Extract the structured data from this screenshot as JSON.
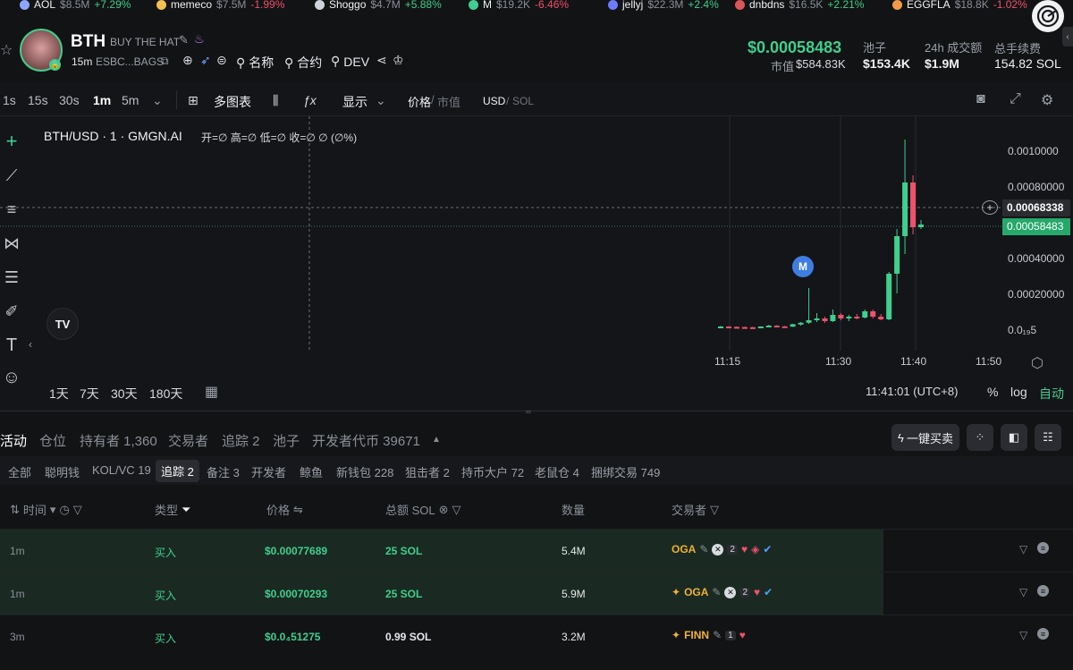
{
  "ticker": [
    {
      "name": "AOL",
      "mcap": "$8.5M",
      "change": "+7.29%",
      "dir": "up",
      "color": "#8fa6ff"
    },
    {
      "name": "memeco",
      "mcap": "$7.5M",
      "change": "-1.99%",
      "dir": "dn",
      "color": "#f2c14e"
    },
    {
      "name": "Shoggo",
      "mcap": "$4.7M",
      "change": "+5.88%",
      "dir": "up",
      "color": "#cfd3da"
    },
    {
      "name": "M",
      "mcap": "$19.2K",
      "change": "-6.46%",
      "dir": "dn",
      "color": "#3fcf8e"
    },
    {
      "name": "jellyj",
      "mcap": "$22.3M",
      "change": "+2.4%",
      "dir": "up",
      "color": "#6c7cff"
    },
    {
      "name": "dnbdns",
      "mcap": "$16.5K",
      "change": "+2.21%",
      "dir": "up",
      "color": "#d95757"
    },
    {
      "name": "EGGFLA",
      "mcap": "$18.8K",
      "change": "-1.02%",
      "dir": "dn",
      "color": "#f39a4a"
    }
  ],
  "token": {
    "symbol": "BTH",
    "fullname": "BUY THE HAT",
    "age": "15m",
    "address": "ESBC...BAGS",
    "links": [
      "名称",
      "合约",
      "DEV"
    ]
  },
  "stats": {
    "price": "$0.00058483",
    "mcap_label": "市值",
    "mcap": "$584.83K",
    "pool_label": "池子",
    "pool": "$153.4K",
    "vol_label": "24h 成交额",
    "vol": "$1.9M",
    "fee_label": "总手续费",
    "fee": "154.82 SOL"
  },
  "toolbar": {
    "intervals": [
      "1s",
      "15s",
      "30s",
      "1m",
      "5m"
    ],
    "active_interval": "1m",
    "multi": "多图表",
    "display": "显示",
    "price_label": "价格",
    "mcap_label": "市值",
    "usd_label": "USD",
    "sol_label": "SOL"
  },
  "chart": {
    "legend": "BTH/USD · 1 · GMGN.AI",
    "ohlc": "开=∅ 高=∅ 低=∅ 收=∅ ∅ (∅%)",
    "crosshair_price": "0.00068338",
    "last_price": "0.00058483",
    "y_ticks": [
      "0.0010000",
      "0.00080000",
      "0.00060000",
      "0.00040000",
      "0.00020000",
      "0.0₁₉5"
    ],
    "x_ticks": [
      "11:15",
      "11:30",
      "11:40",
      "11:50"
    ],
    "ranges": [
      "1天",
      "7天",
      "30天",
      "180天"
    ],
    "time": "11:41:01 (UTC+8)",
    "pct": "%",
    "log": "log",
    "auto": "自动",
    "marker": "M",
    "tv_logo": "TV"
  },
  "chart_data": {
    "type": "candlestick",
    "ylim": [
      0,
      0.0011
    ],
    "x_ticks": [
      "11:15",
      "11:30",
      "11:40",
      "11:50"
    ],
    "candles_note": "",
    "candles": [
      {
        "o": 1.2e-05,
        "h": 1.8e-05,
        "l": 1e-05,
        "c": 1.5e-05
      },
      {
        "o": 1.5e-05,
        "h": 1.6e-05,
        "l": 1.2e-05,
        "c": 1.3e-05
      },
      {
        "o": 1.3e-05,
        "h": 1.5e-05,
        "l": 1.1e-05,
        "c": 1.2e-05
      },
      {
        "o": 1.2e-05,
        "h": 1.4e-05,
        "l": 1e-05,
        "c": 1.1e-05
      },
      {
        "o": 1.1e-05,
        "h": 1.3e-05,
        "l": 9e-06,
        "c": 1e-05
      },
      {
        "o": 1e-05,
        "h": 1.6e-05,
        "l": 9e-06,
        "c": 1.5e-05
      },
      {
        "o": 1.5e-05,
        "h": 2.4e-05,
        "l": 1.3e-05,
        "c": 2e-05
      },
      {
        "o": 2e-05,
        "h": 2.2e-05,
        "l": 1.4e-05,
        "c": 1.6e-05
      },
      {
        "o": 1.6e-05,
        "h": 1.8e-05,
        "l": 1.3e-05,
        "c": 1.4e-05
      },
      {
        "o": 1.4e-05,
        "h": 3e-05,
        "l": 1.3e-05,
        "c": 2.8e-05
      },
      {
        "o": 2.8e-05,
        "h": 4e-05,
        "l": 2e-05,
        "c": 3.6e-05
      },
      {
        "o": 3.6e-05,
        "h": 0.00023,
        "l": 3e-05,
        "c": 5e-05
      },
      {
        "o": 5e-05,
        "h": 9e-05,
        "l": 4e-05,
        "c": 6e-05
      },
      {
        "o": 6e-05,
        "h": 7e-05,
        "l": 3.5e-05,
        "c": 4.5e-05
      },
      {
        "o": 4.5e-05,
        "h": 0.00011,
        "l": 4e-05,
        "c": 8e-05
      },
      {
        "o": 8e-05,
        "h": 9e-05,
        "l": 5e-05,
        "c": 6e-05
      },
      {
        "o": 6e-05,
        "h": 8e-05,
        "l": 4.5e-05,
        "c": 7e-05
      },
      {
        "o": 7e-05,
        "h": 8.5e-05,
        "l": 5.5e-05,
        "c": 6.5e-05
      },
      {
        "o": 6.5e-05,
        "h": 0.00011,
        "l": 6e-05,
        "c": 0.0001
      },
      {
        "o": 0.0001,
        "h": 0.00011,
        "l": 6e-05,
        "c": 7e-05
      },
      {
        "o": 7e-05,
        "h": 8.5e-05,
        "l": 5e-05,
        "c": 5.5e-05
      },
      {
        "o": 5.5e-05,
        "h": 0.00032,
        "l": 5e-05,
        "c": 0.00031
      },
      {
        "o": 0.00031,
        "h": 0.00056,
        "l": 0.0002,
        "c": 0.00052
      },
      {
        "o": 0.00052,
        "h": 0.00106,
        "l": 0.00042,
        "c": 0.00082
      },
      {
        "o": 0.00082,
        "h": 0.00086,
        "l": 0.00053,
        "c": 0.00057
      },
      {
        "o": 0.00057,
        "h": 0.00061,
        "l": 0.00056,
        "c": 0.000585
      }
    ]
  },
  "tabs": {
    "main": [
      "活动",
      "仓位",
      "持有者 1,360",
      "交易者",
      "追踪 2",
      "池子",
      "开发者代币 39671"
    ],
    "active": "活动",
    "quick_buy": "一键买卖",
    "sub": [
      "全部",
      "聪明钱",
      "KOL/VC 19",
      "追踪 2",
      "备注 3",
      "开发者",
      "鲸鱼",
      "新钱包 228",
      "狙击者 2",
      "持币大户 72",
      "老鼠仓 4",
      "捆绑交易 749"
    ],
    "sub_active": "追踪 2"
  },
  "table": {
    "headers": {
      "time": "时间",
      "type": "类型",
      "price": "价格",
      "total": "总额 SOL",
      "qty": "数量",
      "trader": "交易者"
    },
    "rows": [
      {
        "time": "1m",
        "type": "买入",
        "price": "$0.00077689",
        "total": "25 SOL",
        "qty": "5.4M",
        "trader": "OGA",
        "count": "2",
        "highlight": true
      },
      {
        "time": "1m",
        "type": "买入",
        "price": "$0.00070293",
        "total": "25 SOL",
        "qty": "5.9M",
        "trader": "OGA",
        "count": "2",
        "highlight": true
      },
      {
        "time": "3m",
        "type": "买入",
        "price": "$0.0₄51275",
        "total": "0.99 SOL",
        "qty": "3.2M",
        "trader": "FINN",
        "count": "1",
        "highlight": false
      }
    ]
  },
  "colors": {
    "up": "#3fcf8e",
    "down": "#f0516b",
    "accent": "#f0b232"
  }
}
